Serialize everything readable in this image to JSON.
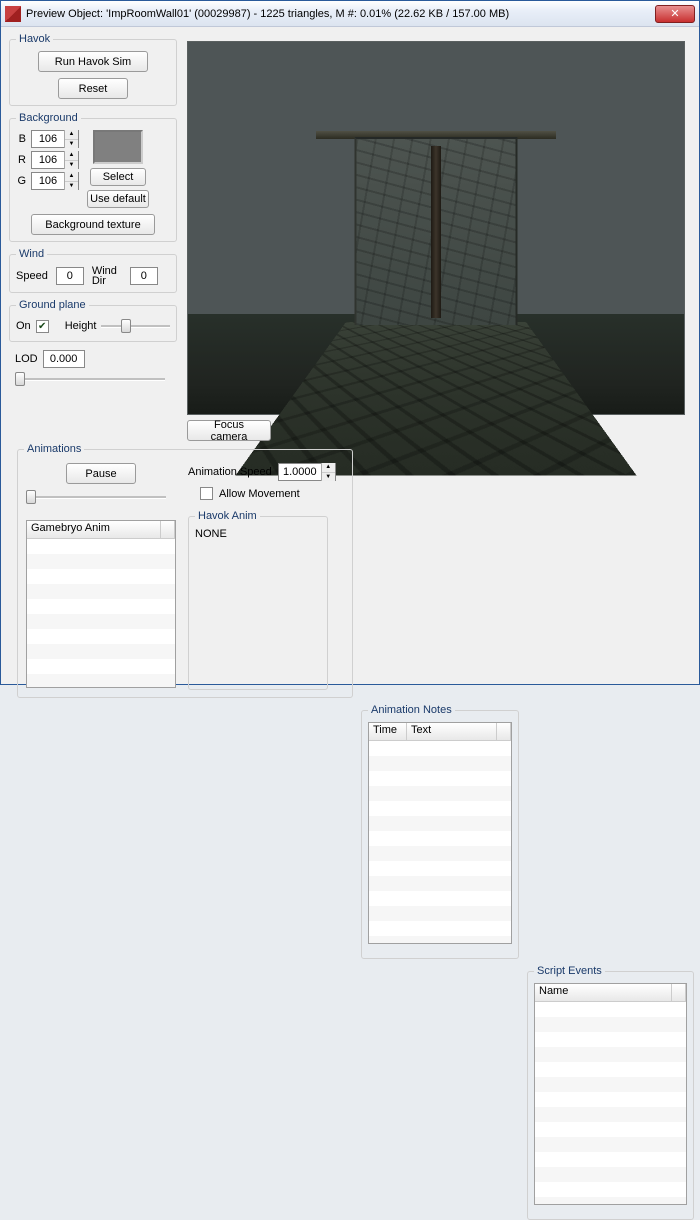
{
  "title": "Preview Object: 'ImpRoomWall01' (00029987) - 1225 triangles, M #: 0.01% (22.62 KB / 157.00 MB)",
  "close_glyph": "✕",
  "havok": {
    "legend": "Havok",
    "run": "Run Havok Sim",
    "reset": "Reset"
  },
  "background": {
    "legend": "Background",
    "b_label": "B",
    "r_label": "R",
    "g_label": "G",
    "b": "106",
    "r": "106",
    "g": "106",
    "select": "Select",
    "use_default": "Use default",
    "texture": "Background texture"
  },
  "wind": {
    "legend": "Wind",
    "speed_label": "Speed",
    "speed": "0",
    "dir_label": "Wind Dir",
    "dir": "0"
  },
  "ground": {
    "legend": "Ground plane",
    "on_label": "On",
    "on_checked": true,
    "height_label": "Height"
  },
  "lod_label": "LOD",
  "lod": "0.000",
  "focus": "Focus camera",
  "animations": {
    "legend": "Animations",
    "pause": "Pause",
    "speed_label": "Animation Speed",
    "speed": "1.0000",
    "allow_movement": "Allow Movement",
    "gamebryo_header": "Gamebryo Anim",
    "havok_legend": "Havok Anim",
    "havok_value": "NONE"
  },
  "anim_notes": {
    "legend": "Animation Notes",
    "col_time": "Time",
    "col_text": "Text"
  },
  "script_events": {
    "legend": "Script Events",
    "col_name": "Name"
  }
}
